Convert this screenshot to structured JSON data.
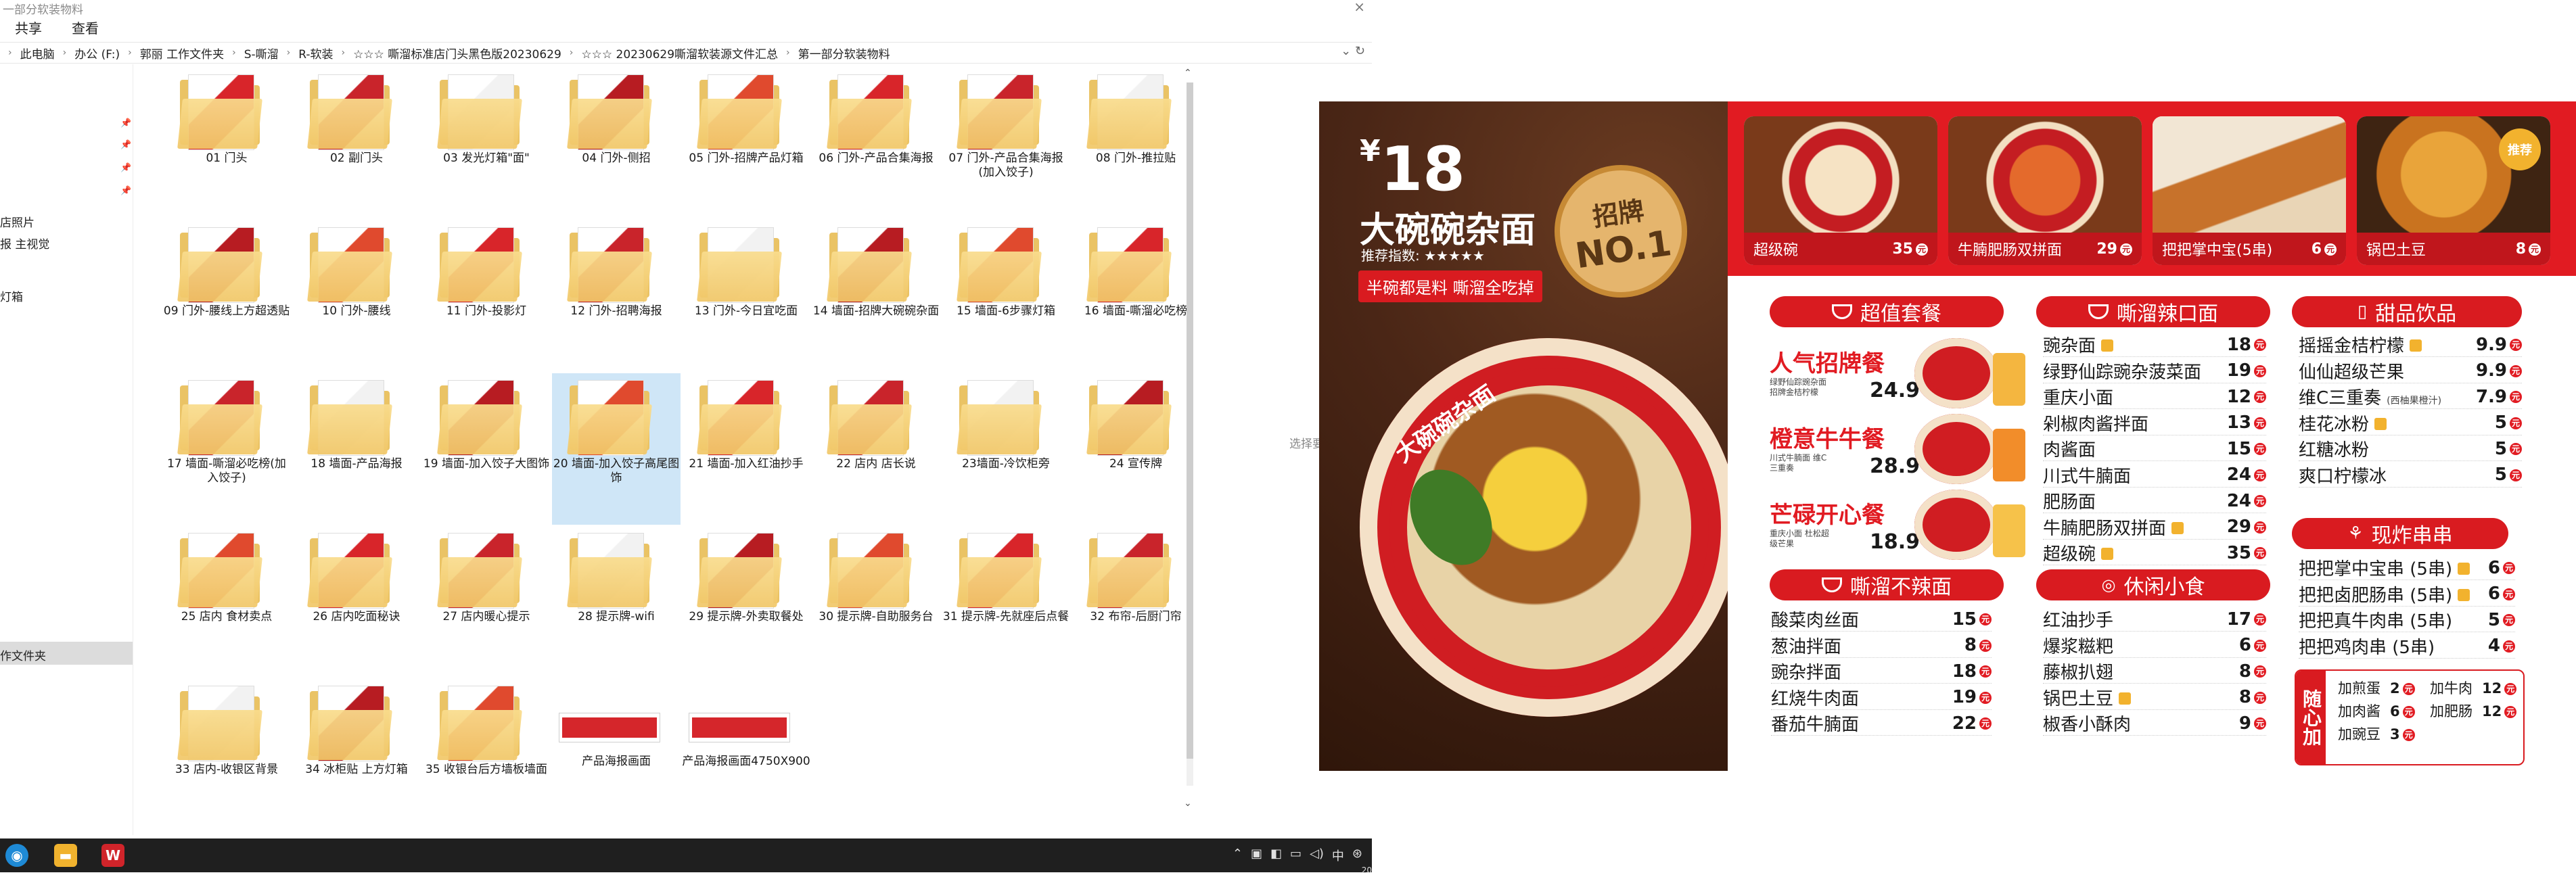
{
  "window": {
    "title": "一部分软装物料"
  },
  "ribbon": {
    "tabs": [
      "共享",
      "查看"
    ]
  },
  "address": {
    "crumbs": [
      "此电脑",
      "办公 (F:)",
      "郭丽 工作文件夹",
      "S-嘶溜",
      "R-软装",
      "☆☆☆ 嘶溜标准店门头黑色版20230629",
      "☆☆☆ 20230629嘶溜软装源文件汇总",
      "第一部分软装物料"
    ]
  },
  "nav": {
    "items": [
      "店照片",
      "报 主视觉",
      "灯箱",
      "作文件夹"
    ]
  },
  "folders": [
    {
      "label": "01 门头"
    },
    {
      "label": "02 副门头"
    },
    {
      "label": "03 发光灯箱\"面\""
    },
    {
      "label": "04 门外-侧招"
    },
    {
      "label": "05 门外-招牌产品灯箱"
    },
    {
      "label": "06 门外-产品合集海报"
    },
    {
      "label": "07 门外-产品合集海报(加入饺子)"
    },
    {
      "label": "08 门外-推拉贴"
    },
    {
      "label": "09 门外-腰线上方超透贴"
    },
    {
      "label": "10 门外-腰线"
    },
    {
      "label": "11 门外-投影灯"
    },
    {
      "label": "12 门外-招聘海报"
    },
    {
      "label": "13 门外-今日宜吃面"
    },
    {
      "label": "14 墙面-招牌大碗碗杂面"
    },
    {
      "label": "15 墙面-6步骤灯箱"
    },
    {
      "label": "16 墙面-嘶溜必吃榜"
    },
    {
      "label": "17 墙面-嘶溜必吃榜(加入饺子)"
    },
    {
      "label": "18 墙面-产品海报"
    },
    {
      "label": "19 墙面-加入饺子大图饰"
    },
    {
      "label": "20 墙面-加入饺子高尾图饰"
    },
    {
      "label": "21 墙面-加入红油抄手"
    },
    {
      "label": "22 店内 店长说"
    },
    {
      "label": "23墙面-冷饮柜旁"
    },
    {
      "label": "24 宣传牌"
    },
    {
      "label": "25 店内 食材卖点"
    },
    {
      "label": "26 店内吃面秘诀"
    },
    {
      "label": "27 店内暖心提示"
    },
    {
      "label": "28 提示牌-wifi"
    },
    {
      "label": "29 提示牌-外卖取餐处"
    },
    {
      "label": "30 提示牌-自助服务台"
    },
    {
      "label": "31 提示牌-先就座后点餐"
    },
    {
      "label": "32 布帘-后厨门帘"
    },
    {
      "label": "33 店内-收银区背景"
    },
    {
      "label": "34 冰柜贴 上方灯箱"
    },
    {
      "label": "35 收银台后方墙板墙面"
    }
  ],
  "images": [
    {
      "label": "产品海报画面"
    },
    {
      "label": "产品海报画面4750X900"
    }
  ],
  "side_hint": "选择要",
  "taskbar": {
    "wps_label": "W",
    "time": "20"
  },
  "menu": {
    "hero": {
      "yen": "¥",
      "price": "18",
      "name": "大碗碗杂面",
      "recommend": "推荐指数: ★★★★★",
      "slogan": "半碗都是料 嘶溜全吃掉",
      "badge_top": "招牌",
      "badge_bottom": "NO.1",
      "bowl_text": "大碗碗杂面"
    },
    "featured": [
      {
        "name": "超级碗",
        "price": "35"
      },
      {
        "name": "牛腩肥肠双拼面",
        "price": "29"
      },
      {
        "name": "把把掌中宝(5串)",
        "price": "6"
      },
      {
        "name": "锅巴土豆",
        "price": "8"
      }
    ],
    "featured_tag": "推荐",
    "value_meals": {
      "title": "超值套餐",
      "items": [
        {
          "name": "人气招牌餐",
          "desc": "绿野仙踪豌杂面 招牌金桔柠檬",
          "price": "24.9"
        },
        {
          "name": "橙意牛牛餐",
          "desc": "川式牛腩面 维C三重奏",
          "price": "28.9"
        },
        {
          "name": "芒碌开心餐",
          "desc": "重庆小面 杜松超级芒果",
          "price": "18.9"
        }
      ]
    },
    "spicy": {
      "title": "嘶溜辣口面",
      "items": [
        {
          "name": "豌杂面",
          "price": "18",
          "thumb": true
        },
        {
          "name": "绿野仙踪豌杂菠菜面",
          "price": "19",
          "thumb": false
        },
        {
          "name": "重庆小面",
          "price": "12",
          "thumb": false
        },
        {
          "name": "剁椒肉酱拌面",
          "price": "13",
          "thumb": false
        },
        {
          "name": "肉酱面",
          "price": "15",
          "thumb": false
        },
        {
          "name": "川式牛腩面",
          "price": "24",
          "thumb": false
        },
        {
          "name": "肥肠面",
          "price": "24",
          "thumb": false
        },
        {
          "name": "牛腩肥肠双拼面",
          "price": "29",
          "thumb": true
        },
        {
          "name": "超级碗",
          "price": "35",
          "thumb": true
        }
      ]
    },
    "desserts": {
      "title": "甜品饮品",
      "items": [
        {
          "name": "摇摇金桔柠檬",
          "price": "9.9",
          "thumb": true
        },
        {
          "name": "仙仙超级芒果",
          "price": "9.9",
          "thumb": false
        },
        {
          "name": "维C三重奏",
          "note": "(西柚果橙汁)",
          "price": "7.9",
          "thumb": false
        },
        {
          "name": "桂花冰粉",
          "price": "5",
          "thumb": true
        },
        {
          "name": "红糖冰粉",
          "price": "5",
          "thumb": false
        },
        {
          "name": "爽口柠檬冰",
          "price": "5",
          "thumb": false
        }
      ]
    },
    "not_spicy": {
      "title": "嘶溜不辣面",
      "items": [
        {
          "name": "酸菜肉丝面",
          "price": "15"
        },
        {
          "name": "葱油拌面",
          "price": "8"
        },
        {
          "name": "豌杂拌面",
          "price": "18"
        },
        {
          "name": "红烧牛肉面",
          "price": "19"
        },
        {
          "name": "番茄牛腩面",
          "price": "22"
        }
      ]
    },
    "snacks": {
      "title": "休闲小食",
      "items": [
        {
          "name": "红油抄手",
          "price": "17",
          "thumb": false
        },
        {
          "name": "爆浆糍粑",
          "price": "6",
          "thumb": false
        },
        {
          "name": "藤椒扒翅",
          "price": "8",
          "thumb": false
        },
        {
          "name": "锅巴土豆",
          "price": "8",
          "thumb": true
        },
        {
          "name": "椒香小酥肉",
          "price": "9",
          "thumb": false
        }
      ]
    },
    "skewers": {
      "title": "现炸串串",
      "items": [
        {
          "name": "把把掌中宝串 (5串)",
          "price": "6",
          "thumb": true
        },
        {
          "name": "把把卤肥肠串 (5串)",
          "price": "6",
          "thumb": true
        },
        {
          "name": "把把真牛肉串 (5串)",
          "price": "5",
          "thumb": false
        },
        {
          "name": "把把鸡肉串 (5串)",
          "price": "4",
          "thumb": false
        }
      ]
    },
    "extras": {
      "tag": "随心加",
      "items": [
        {
          "name": "加煎蛋",
          "price": "2"
        },
        {
          "name": "加牛肉",
          "price": "12"
        },
        {
          "name": "加肉酱",
          "price": "6"
        },
        {
          "name": "加肥肠",
          "price": "12"
        },
        {
          "name": "加豌豆",
          "price": "3"
        }
      ]
    },
    "colors": {
      "brand_red": "#e11b22",
      "dark_red": "#c0161c",
      "accent_gold": "#f2b22e"
    }
  }
}
